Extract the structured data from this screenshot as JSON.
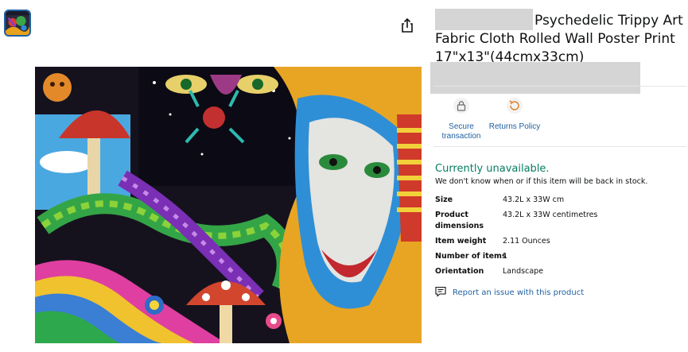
{
  "product": {
    "title": "Psychedelic Trippy Art Fabric Cloth Rolled Wall Poster Print 17\"x13\"(44cmx33cm)"
  },
  "badges": [
    {
      "icon": "lock-icon",
      "label": "Secure transaction"
    },
    {
      "icon": "returns-icon",
      "label": "Returns Policy"
    }
  ],
  "availability": {
    "status": "Currently unavailable.",
    "note": "We don't know when or if this item will be back in stock."
  },
  "specs": [
    {
      "label": "Size",
      "value": "43.2L x 33W cm"
    },
    {
      "label": "Product dimensions",
      "value": "43.2L x 33W centimetres"
    },
    {
      "label": "Item weight",
      "value": "2.11 Ounces"
    },
    {
      "label": "Number of items",
      "value": "1"
    },
    {
      "label": "Orientation",
      "value": "Landscape"
    }
  ],
  "report": {
    "label": "Report an issue with this product",
    "icon": "report-icon"
  },
  "colors": {
    "link": "#2162a1",
    "available": "#067d62",
    "redaction": "#d5d5d5"
  }
}
